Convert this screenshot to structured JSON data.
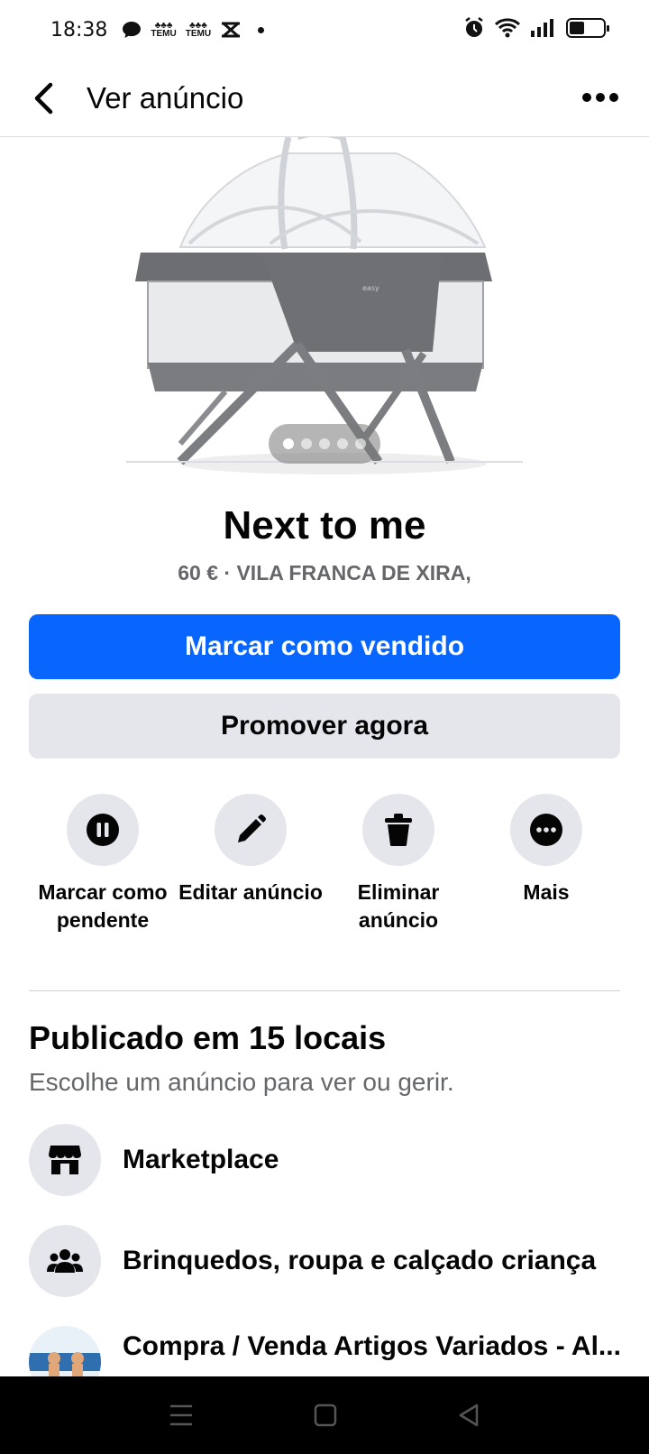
{
  "status_bar": {
    "time": "18:38",
    "notif_icons": [
      "chat-bubble-icon",
      "temu-icon",
      "temu-icon",
      "capcut-icon",
      "dot-icon"
    ],
    "temu_text": "TEMU",
    "battery_level": 0.45
  },
  "header": {
    "title": "Ver anúncio"
  },
  "gallery": {
    "image_count": 5,
    "active_index": 0
  },
  "listing": {
    "title": "Next to me",
    "subtitle": "60 € · VILA FRANCA DE XIRA,"
  },
  "buttons": {
    "mark_sold": "Marcar como vendido",
    "promote": "Promover agora"
  },
  "actions": [
    {
      "label": "Marcar como pendente",
      "icon": "pause-icon"
    },
    {
      "label": "Editar anúncio",
      "icon": "pencil-icon"
    },
    {
      "label": "Eliminar anúncio",
      "icon": "trash-icon"
    },
    {
      "label": "Mais",
      "icon": "more-icon"
    }
  ],
  "published": {
    "title": "Publicado em 15 locais",
    "subtitle": "Escolhe um anúncio para ver ou gerir.",
    "locations": [
      {
        "label": "Marketplace",
        "icon": "shop-icon"
      },
      {
        "label": "Brinquedos, roupa e calçado criança",
        "icon": "group-icon"
      },
      {
        "label": "Compra / Venda Artigos Variados - Al...",
        "icon": "group-avatar-icon"
      }
    ]
  },
  "colors": {
    "primary": "#0866ff",
    "secondary_bg": "#e4e6eb",
    "text": "#050505",
    "muted": "#65676b"
  }
}
